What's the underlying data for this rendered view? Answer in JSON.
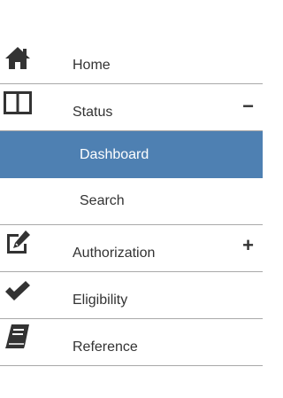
{
  "nav": {
    "items": [
      {
        "label": "Home",
        "icon": "home-icon"
      },
      {
        "label": "Status",
        "icon": "panel-icon",
        "toggle": "−"
      },
      {
        "label": "Authorization",
        "icon": "edit-icon",
        "toggle": "+"
      },
      {
        "label": "Eligibility",
        "icon": "checkmark-icon"
      },
      {
        "label": "Reference",
        "icon": "book-icon"
      }
    ],
    "status_children": [
      {
        "label": "Dashboard",
        "active": true
      },
      {
        "label": "Search",
        "active": false
      }
    ]
  },
  "colors": {
    "active_bg": "#4e80b2",
    "divider": "#a9a9a9",
    "text": "#333333"
  }
}
